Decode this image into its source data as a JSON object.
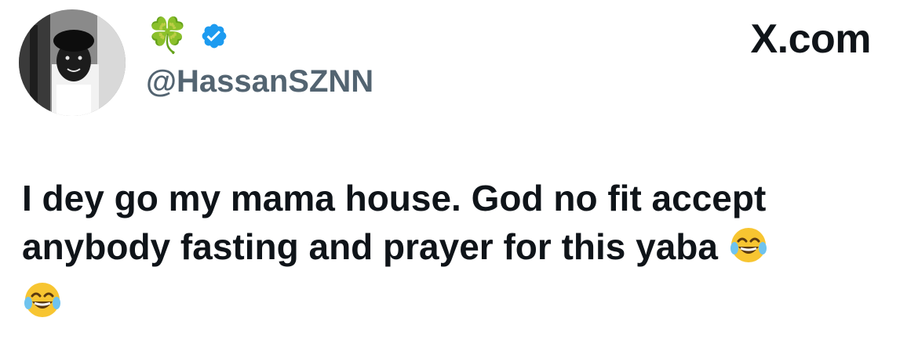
{
  "author": {
    "display_name": "🍀",
    "handle": "@HassanSZNN",
    "verified_icon": "verified-badge-icon",
    "avatar": "profile-photo-child",
    "verified_color": "#1d9bf0"
  },
  "brand": {
    "label": "X.com"
  },
  "tweet": {
    "line1": "I dey go my mama house. God no fit accept",
    "line2": "anybody fasting and prayer for this yaba ",
    "emoji_name": "face-with-tears-of-joy-icon"
  },
  "colors": {
    "text": "#0f1419",
    "handle": "#536471",
    "background": "#ffffff"
  }
}
